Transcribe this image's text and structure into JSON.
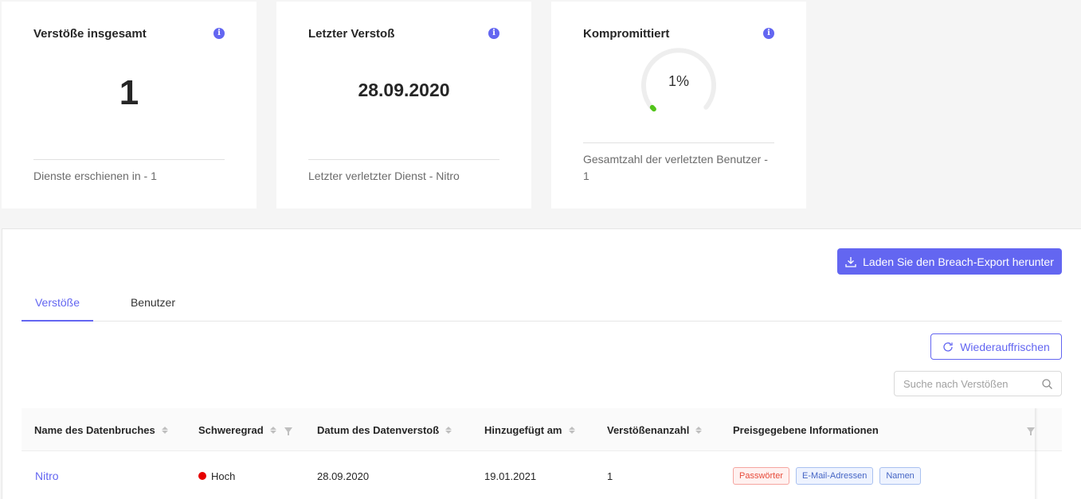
{
  "cards": {
    "total": {
      "title": "Verstöße insgesamt",
      "value": "1",
      "footer": "Dienste erschienen in - 1"
    },
    "last": {
      "title": "Letzter Verstoß",
      "value": "28.09.2020",
      "footer": "Letzter verletzter Dienst - Nitro"
    },
    "compromised": {
      "title": "Kompromittiert",
      "value": "1%",
      "progress": 0.01,
      "footer": "Gesamtzahl der verletzten Benutzer - 1"
    }
  },
  "info_glyph": "i",
  "export_button": "Laden Sie den Breach-Export herunter",
  "tabs": [
    "Verstöße",
    "Benutzer"
  ],
  "refresh_button": "Wiederauffrischen",
  "search": {
    "placeholder": "Suche nach Verstößen"
  },
  "table": {
    "columns": [
      "Name des Datenbruches",
      "Schweregrad",
      "Datum des Datenverstoß",
      "Hinzugefügt am",
      "Verstößenanzahl",
      "Preisgegebene Informationen"
    ],
    "rows": [
      {
        "name": "Nitro",
        "severity": "Hoch",
        "date": "28.09.2020",
        "added": "19.01.2021",
        "count": "1",
        "tags": [
          "Passwörter",
          "E-Mail-Adressen",
          "Namen"
        ]
      }
    ]
  },
  "colors": {
    "accent": "#6366f1",
    "severity_high": "#e60000",
    "gauge_fill": "#52c41a"
  }
}
